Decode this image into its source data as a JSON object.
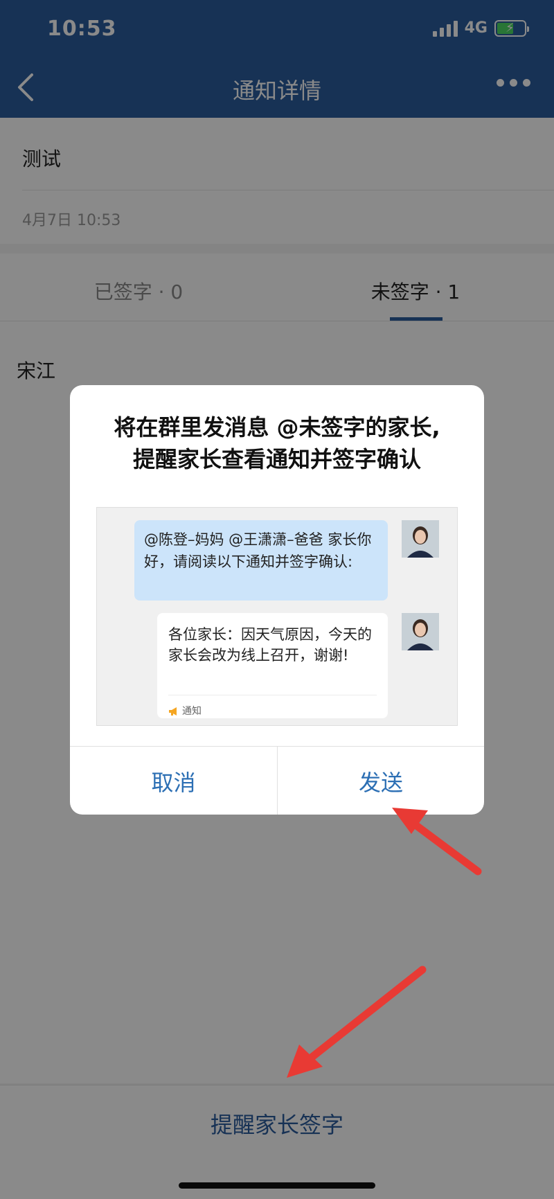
{
  "status_bar": {
    "time": "10:53",
    "network": "4G"
  },
  "nav": {
    "title": "通知详情",
    "back_icon": "chevron-left-icon",
    "more_icon": "more-dots-icon"
  },
  "notice": {
    "title": "测试",
    "time": "4月7日 10:53"
  },
  "tabs": [
    {
      "label": "已签字 · 0",
      "active": false
    },
    {
      "label": "未签字 · 1",
      "active": true
    }
  ],
  "list": {
    "items": [
      "宋江"
    ]
  },
  "bottom_bar": {
    "remind_label": "提醒家长签字"
  },
  "dialog": {
    "title_line1": "将在群里发消息 @未签字的家长,",
    "title_line2": "提醒家长查看通知并签字确认",
    "preview": {
      "mention_message": "@陈登–妈妈 @王潇潇–爸爸 家长你好，请阅读以下通知并签字确认:",
      "notice_message": "各位家长：因天气原因，今天的家长会改为线上召开，谢谢!",
      "notice_tag": "通知"
    },
    "cancel_label": "取消",
    "send_label": "发送"
  },
  "colors": {
    "nav_blue": "#2c5d9e",
    "accent_blue": "#2c6fb4",
    "bubble_blue": "#cce4fa",
    "annotation_red": "#e83a34"
  }
}
